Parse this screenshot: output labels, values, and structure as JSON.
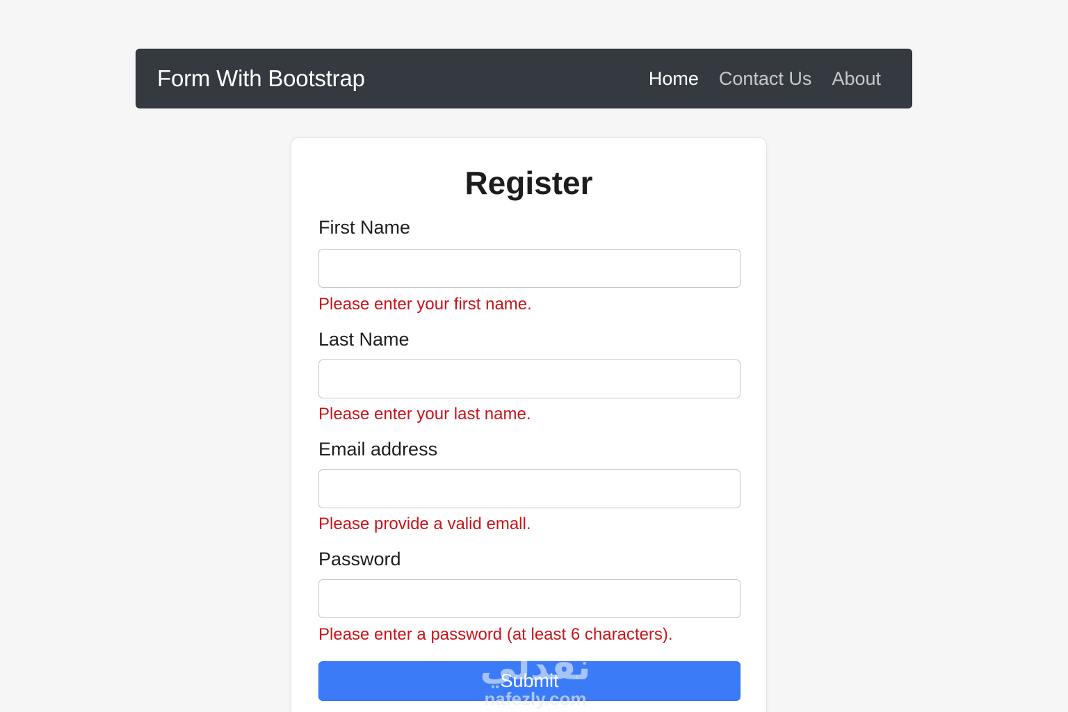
{
  "navbar": {
    "brand": "Form With Bootstrap",
    "links": [
      {
        "label": "Home",
        "active": true
      },
      {
        "label": "Contact Us",
        "active": false
      },
      {
        "label": "About",
        "active": false
      }
    ]
  },
  "form": {
    "title": "Register",
    "fields": [
      {
        "label": "First Name",
        "value": "",
        "error": "Please enter your first name."
      },
      {
        "label": "Last Name",
        "value": "",
        "error": "Please enter your last name."
      },
      {
        "label": "Email address",
        "value": "",
        "error": "Please provide a valid emall."
      },
      {
        "label": "Password",
        "value": "",
        "error": "Please enter a password (at least 6 characters)."
      }
    ],
    "submit_label": "Submit"
  },
  "watermark": {
    "arabic": "نفذلي",
    "domain": "nafezly.com"
  },
  "colors": {
    "navbar_bg": "#353a41",
    "error": "#c8141a",
    "primary": "#3b7bf7",
    "page_bg": "#f6f6f7"
  }
}
